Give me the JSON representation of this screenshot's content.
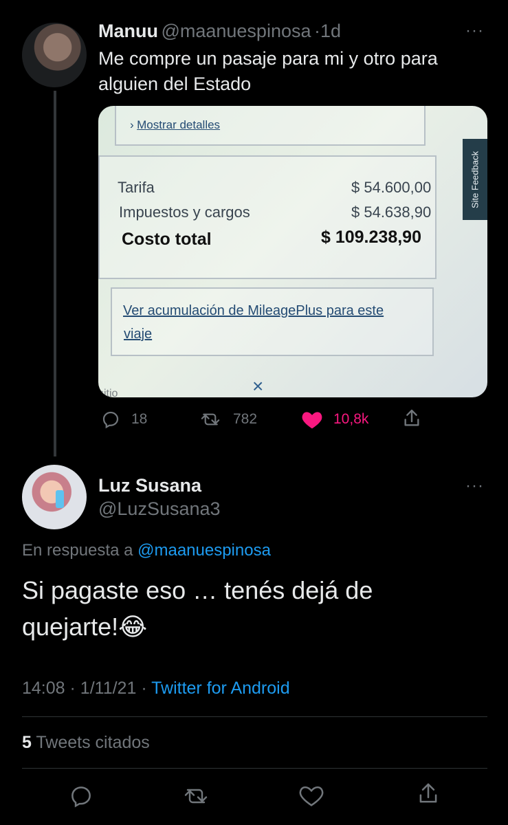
{
  "tweet1": {
    "name": "Manuu",
    "handle": "@maanuespinosa",
    "time_sep": "·",
    "time": "1d",
    "text_line1": "Me compre un pasaje para mi y otro para",
    "text_line2": "alguien del Estado",
    "more_icon": "···",
    "image": {
      "show_details": "Mostrar detalles",
      "site_feedback": "Site Feedback",
      "fare_label": "Tarifa",
      "fare_value": "$ 54.600,00",
      "taxes_label": "Impuestos y cargos",
      "taxes_value": "$ 54.638,90",
      "total_label": "Costo total",
      "total_value": "$ 109.238,90",
      "mileage_line1": "Ver acumulación de MileagePlus para este",
      "mileage_line2": "viaje",
      "close_icon": "×",
      "fragment_text": "sitio"
    },
    "actions": {
      "reply_count": "18",
      "retweet_count": "782",
      "like_count": "10,8k"
    }
  },
  "tweet2": {
    "name": "Luz Susana",
    "handle": "@LuzSusana3",
    "more_icon": "···",
    "reply_prefix": "En respuesta a",
    "reply_to": "@maanuespinosa",
    "text_line1": "Si pagaste eso … tenés dejá de",
    "text_line2": "quejarte!😂",
    "time": "14:08",
    "date": "1/11/21",
    "source": "Twitter for Android",
    "quote_count": "5",
    "quote_label": "Tweets citados"
  },
  "colors": {
    "background": "#000000",
    "text": "#e7e9ea",
    "muted": "#71767b",
    "link": "#1d9bf0",
    "like": "#f91880"
  },
  "icons": {
    "reply": "reply-icon",
    "retweet": "retweet-icon",
    "like": "heart-icon",
    "share": "share-icon"
  }
}
